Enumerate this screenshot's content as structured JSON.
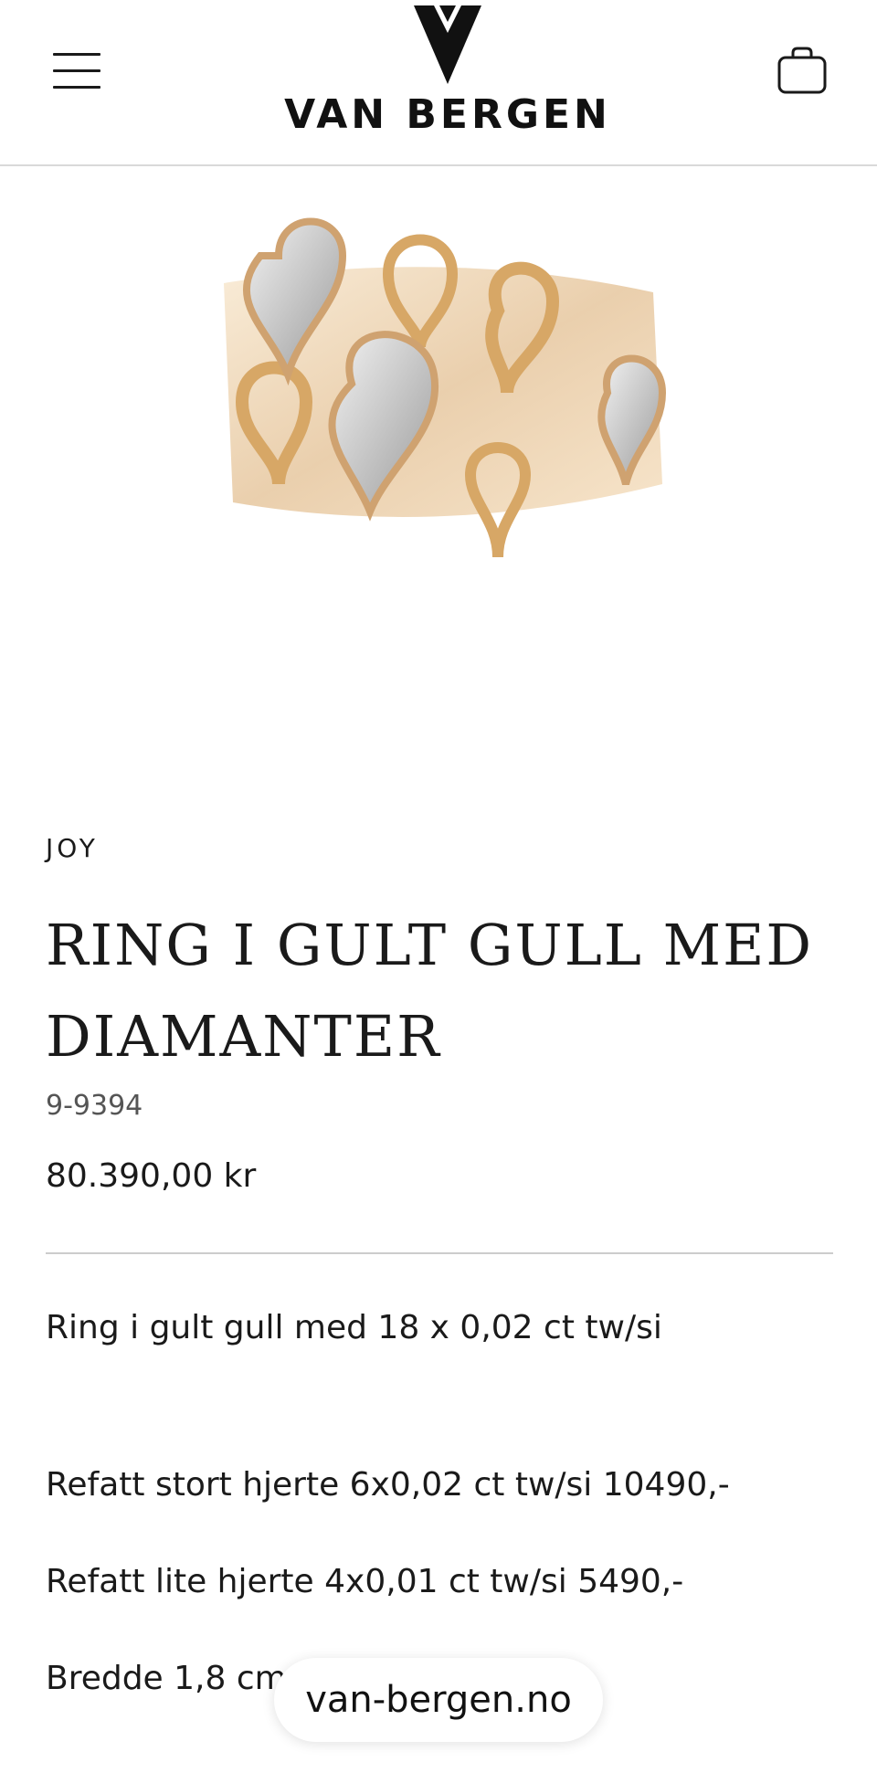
{
  "header": {
    "menu_icon": "hamburger-menu-icon",
    "logo_text": "VAN BERGEN",
    "cart_icon": "shopping-bag-icon"
  },
  "product": {
    "image_alt": "ring-image",
    "brand": "JOY",
    "title": "RING I GULT GULL MED DIAMANTER",
    "sku": "9-9394",
    "price": "80.390,00 kr",
    "description": [
      "Ring i gult gull med 18 x 0,02 ct tw/si",
      "Refatt stort hjerte 6x0,02 ct tw/si 10490,-",
      "Refatt lite hjerte 4x0,01 ct tw/si 5490,-",
      "Bredde 1,8 cm"
    ]
  },
  "browser": {
    "domain": "van-bergen.no"
  }
}
